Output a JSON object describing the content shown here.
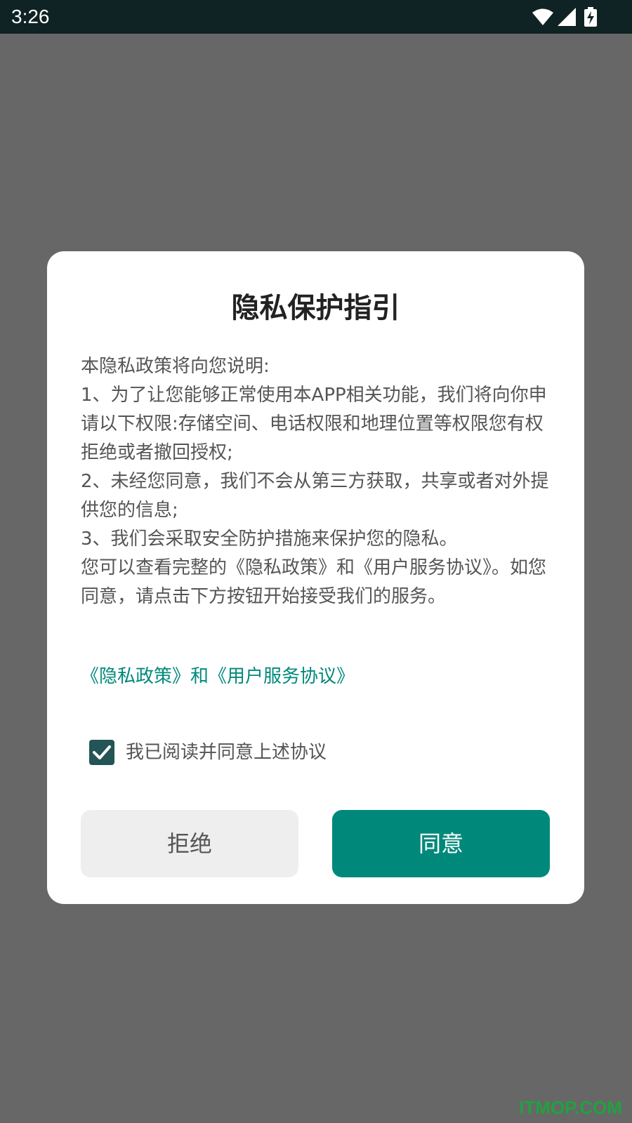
{
  "status_bar": {
    "time": "3:26",
    "icons": [
      "wifi-icon",
      "cell-signal-icon",
      "battery-charging-icon"
    ]
  },
  "dialog": {
    "title": "隐私保护指引",
    "body_lines": [
      "本隐私政策将向您说明:",
      "1、为了让您能够正常使用本APP相关功能，我们将向你申请以下权限:存储空间、电话权限和地理位置等权限您有权拒绝或者撤回授权;",
      "2、未经您同意，我们不会从第三方获取，共享或者对外提供您的信息;",
      "3、我们会采取安全防护措施来保护您的隐私。",
      "您可以查看完整的《隐私政策》和《用户服务协议》。如您同意，请点击下方按钮开始接受我们的服务。"
    ],
    "policy_link_text": "《隐私政策》和《用户服务协议》",
    "agree_checkbox": {
      "label": "我已阅读并同意上述协议",
      "checked": true
    },
    "reject_button": "拒绝",
    "agree_button": "同意"
  },
  "watermark": "ITMOP.COM",
  "colors": {
    "accent": "#00897b",
    "checkbox": "#245455",
    "overlay": "#676767",
    "status_bar": "#0f2224"
  }
}
